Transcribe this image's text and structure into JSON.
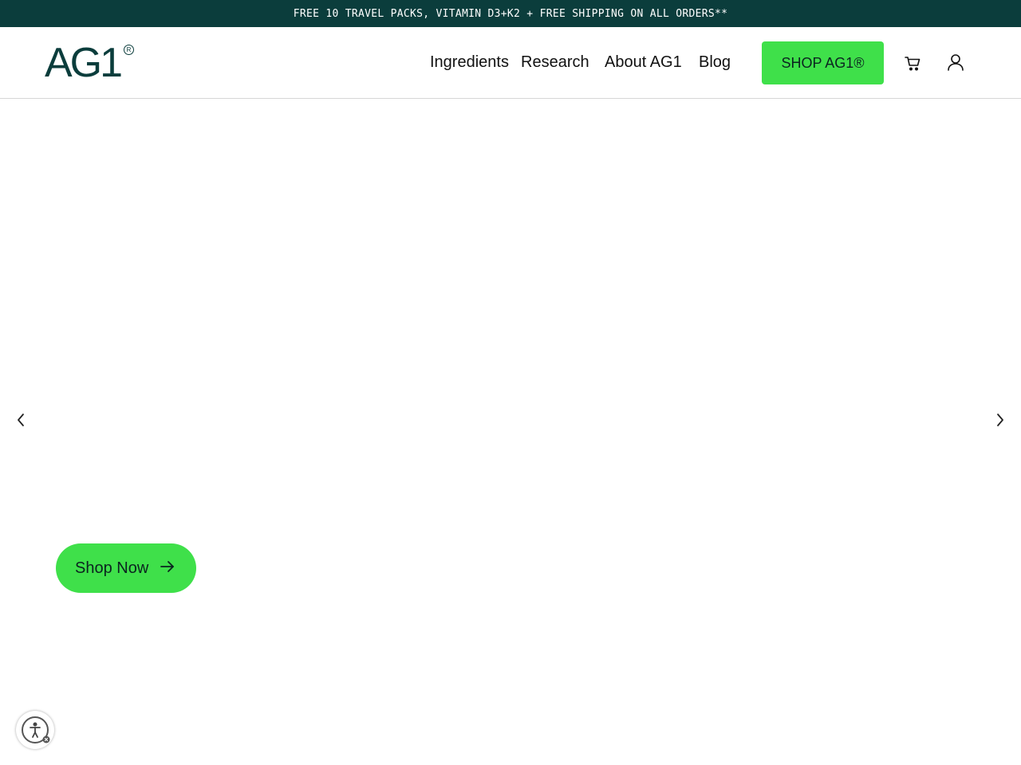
{
  "announcement": {
    "text": "FREE 10 TRAVEL PACKS, VITAMIN D3+K2 + FREE SHIPPING ON ALL ORDERS**"
  },
  "header": {
    "logo": {
      "text": "AG1",
      "registered": "R"
    },
    "nav": [
      {
        "label": "Ingredients"
      },
      {
        "label": "Research"
      },
      {
        "label": "About AG1"
      },
      {
        "label": "Blog"
      }
    ],
    "shop_button": "SHOP AG1®",
    "icons": [
      "cart-icon",
      "account-icon"
    ]
  },
  "hero": {
    "shop_now": "Shop Now",
    "carousel_controls": [
      "chevron-left-icon",
      "chevron-right-icon"
    ]
  },
  "accessibility": {
    "icon": "accessibility-icon"
  },
  "colors": {
    "announcement_bg": "#0b3d3c",
    "brand_dark": "#0b3d3c",
    "cta_green": "#3fe04a"
  }
}
